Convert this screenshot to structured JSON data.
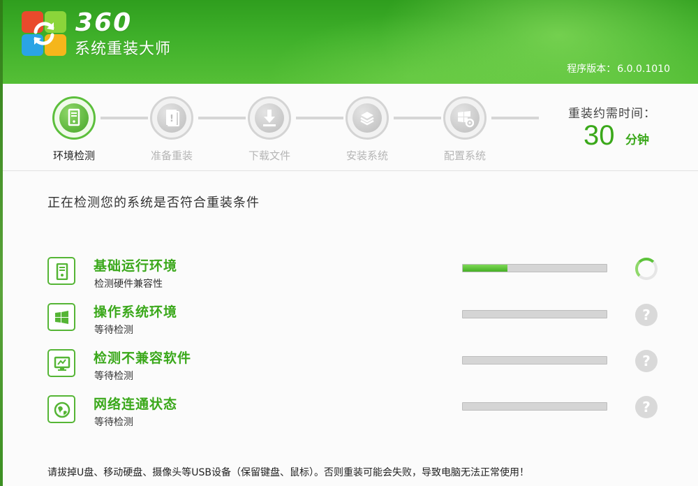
{
  "header": {
    "brand_number": "360",
    "brand_name": "系统重装大师",
    "version_label": "程序版本：",
    "version_value": "6.0.0.1010"
  },
  "steps": [
    {
      "label": "环境检测",
      "icon": "computer-icon",
      "active": true
    },
    {
      "label": "准备重装",
      "icon": "document-icon",
      "active": false
    },
    {
      "label": "下载文件",
      "icon": "download-icon",
      "active": false
    },
    {
      "label": "安装系统",
      "icon": "install-icon",
      "active": false
    },
    {
      "label": "配置系统",
      "icon": "windows-gear-icon",
      "active": false
    }
  ],
  "time": {
    "label": "重装约需时间：",
    "value": "30",
    "unit": "分钟"
  },
  "main": {
    "subtitle": "正在检测您的系统是否符合重装条件",
    "checks": [
      {
        "title": "基础运行环境",
        "status_text": "检测硬件兼容性",
        "progress": 0.31,
        "state": "checking",
        "icon": "computer-icon"
      },
      {
        "title": "操作系统环境",
        "status_text": "等待检测",
        "progress": 0,
        "state": "pending",
        "icon": "windows-icon"
      },
      {
        "title": "检测不兼容软件",
        "status_text": "等待检测",
        "progress": 0,
        "state": "pending",
        "icon": "monitor-icon"
      },
      {
        "title": "网络连通状态",
        "status_text": "等待检测",
        "progress": 0,
        "state": "pending",
        "icon": "globe-icon"
      }
    ],
    "pending_symbol": "?",
    "footer_note": "请拔掉U盘、移动硬盘、摄像头等USB设备（保留键盘、鼠标）。否则重装可能会失败，导致电脑无法正常使用！"
  },
  "colors": {
    "accent": "#3aa81a",
    "header": "#3fb02a"
  }
}
